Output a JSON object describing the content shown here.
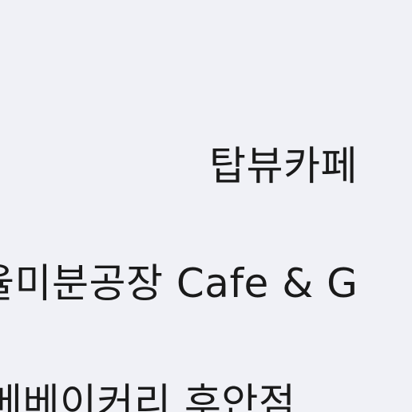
{
  "results": {
    "items": [
      {
        "label": "탑뷰카페"
      },
      {
        "label": "율미분공장 Cafe & G"
      },
      {
        "label": "메베이커리 후안점"
      }
    ]
  }
}
